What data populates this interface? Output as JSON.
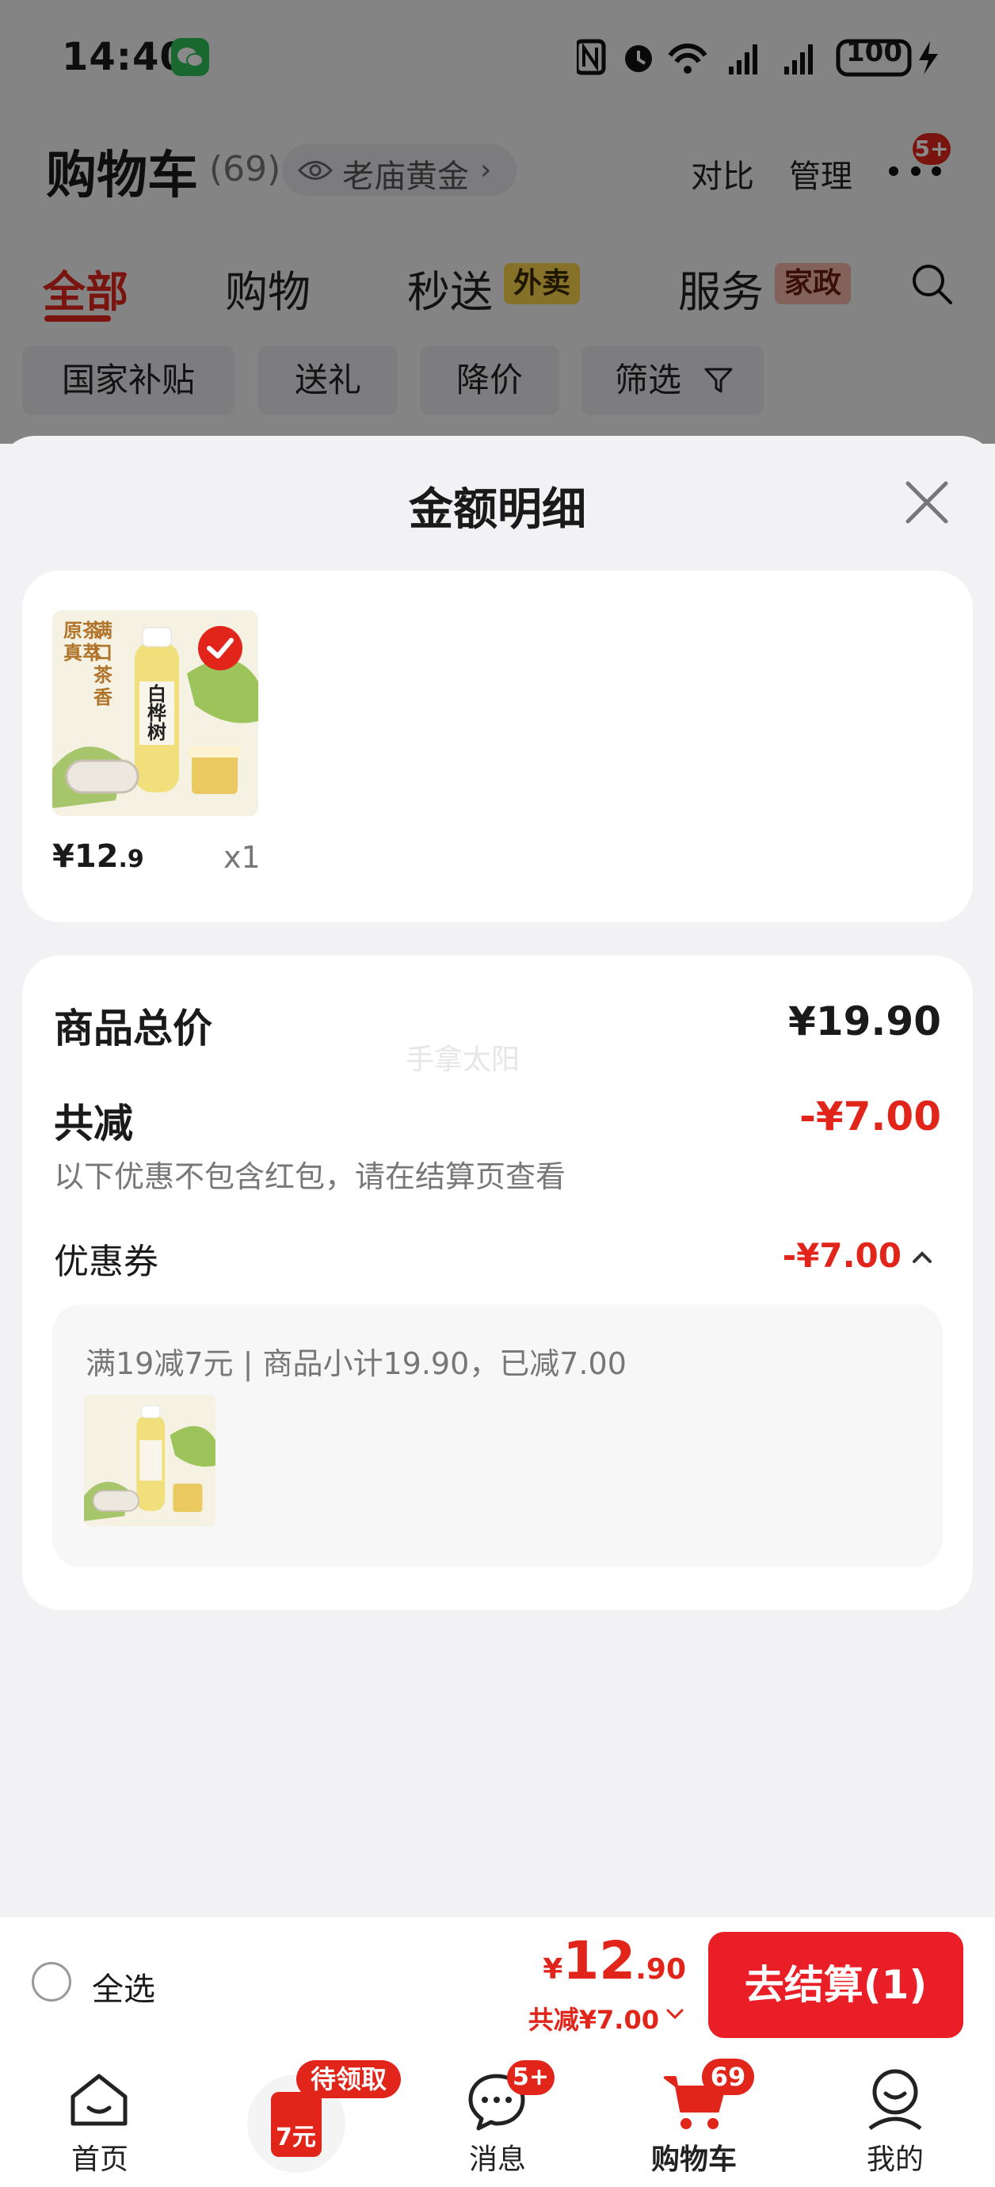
{
  "status_bar": {
    "time": "14:40",
    "battery": "100"
  },
  "header": {
    "title": "购物车",
    "count": "(69)",
    "gold_label": "老庙黄金",
    "compare": "对比",
    "manage": "管理",
    "more_badge": "5+"
  },
  "tabs": [
    {
      "label": "全部"
    },
    {
      "label": "购物"
    },
    {
      "label": "秒送",
      "tag": "外卖"
    },
    {
      "label": "服务",
      "tag": "家政"
    }
  ],
  "chips": [
    "国家补贴",
    "送礼",
    "降价",
    "筛选"
  ],
  "sheet": {
    "title": "金额明细",
    "item": {
      "image_text_left": "原茶真萃",
      "image_text_right": "满口茶香",
      "image_bottle_text": "白桦树",
      "price_symbol": "¥",
      "price_int": "12",
      "price_dec": ".9",
      "qty": "x1"
    },
    "summary": {
      "total_label": "商品总价",
      "total_value": "¥19.90",
      "watermark": "手拿太阳",
      "discount_label": "共减",
      "discount_value": "-¥7.00",
      "note": "以下优惠不包含红包，请在结算页查看",
      "coupon_label": "优惠券",
      "coupon_value": "-¥7.00",
      "coupon_detail": "满19减7元 | 商品小计19.90，已减7.00"
    }
  },
  "checkout": {
    "select_all": "全选",
    "price_symbol": "¥",
    "price_int": "12",
    "price_dec": ".90",
    "saved": "共减¥7.00",
    "button": "去结算(1)"
  },
  "nav": {
    "home": "首页",
    "promo_badge": "待领取",
    "promo_amount": "7元",
    "messages": "消息",
    "messages_badge": "5+",
    "cart": "购物车",
    "cart_badge": "69",
    "mine": "我的"
  },
  "colors": {
    "accent": "#e1251b",
    "overlay": "rgba(0,0,0,0.46)",
    "tag_yellow": "#f6d24a",
    "tag_pink": "#f3b6aa"
  }
}
